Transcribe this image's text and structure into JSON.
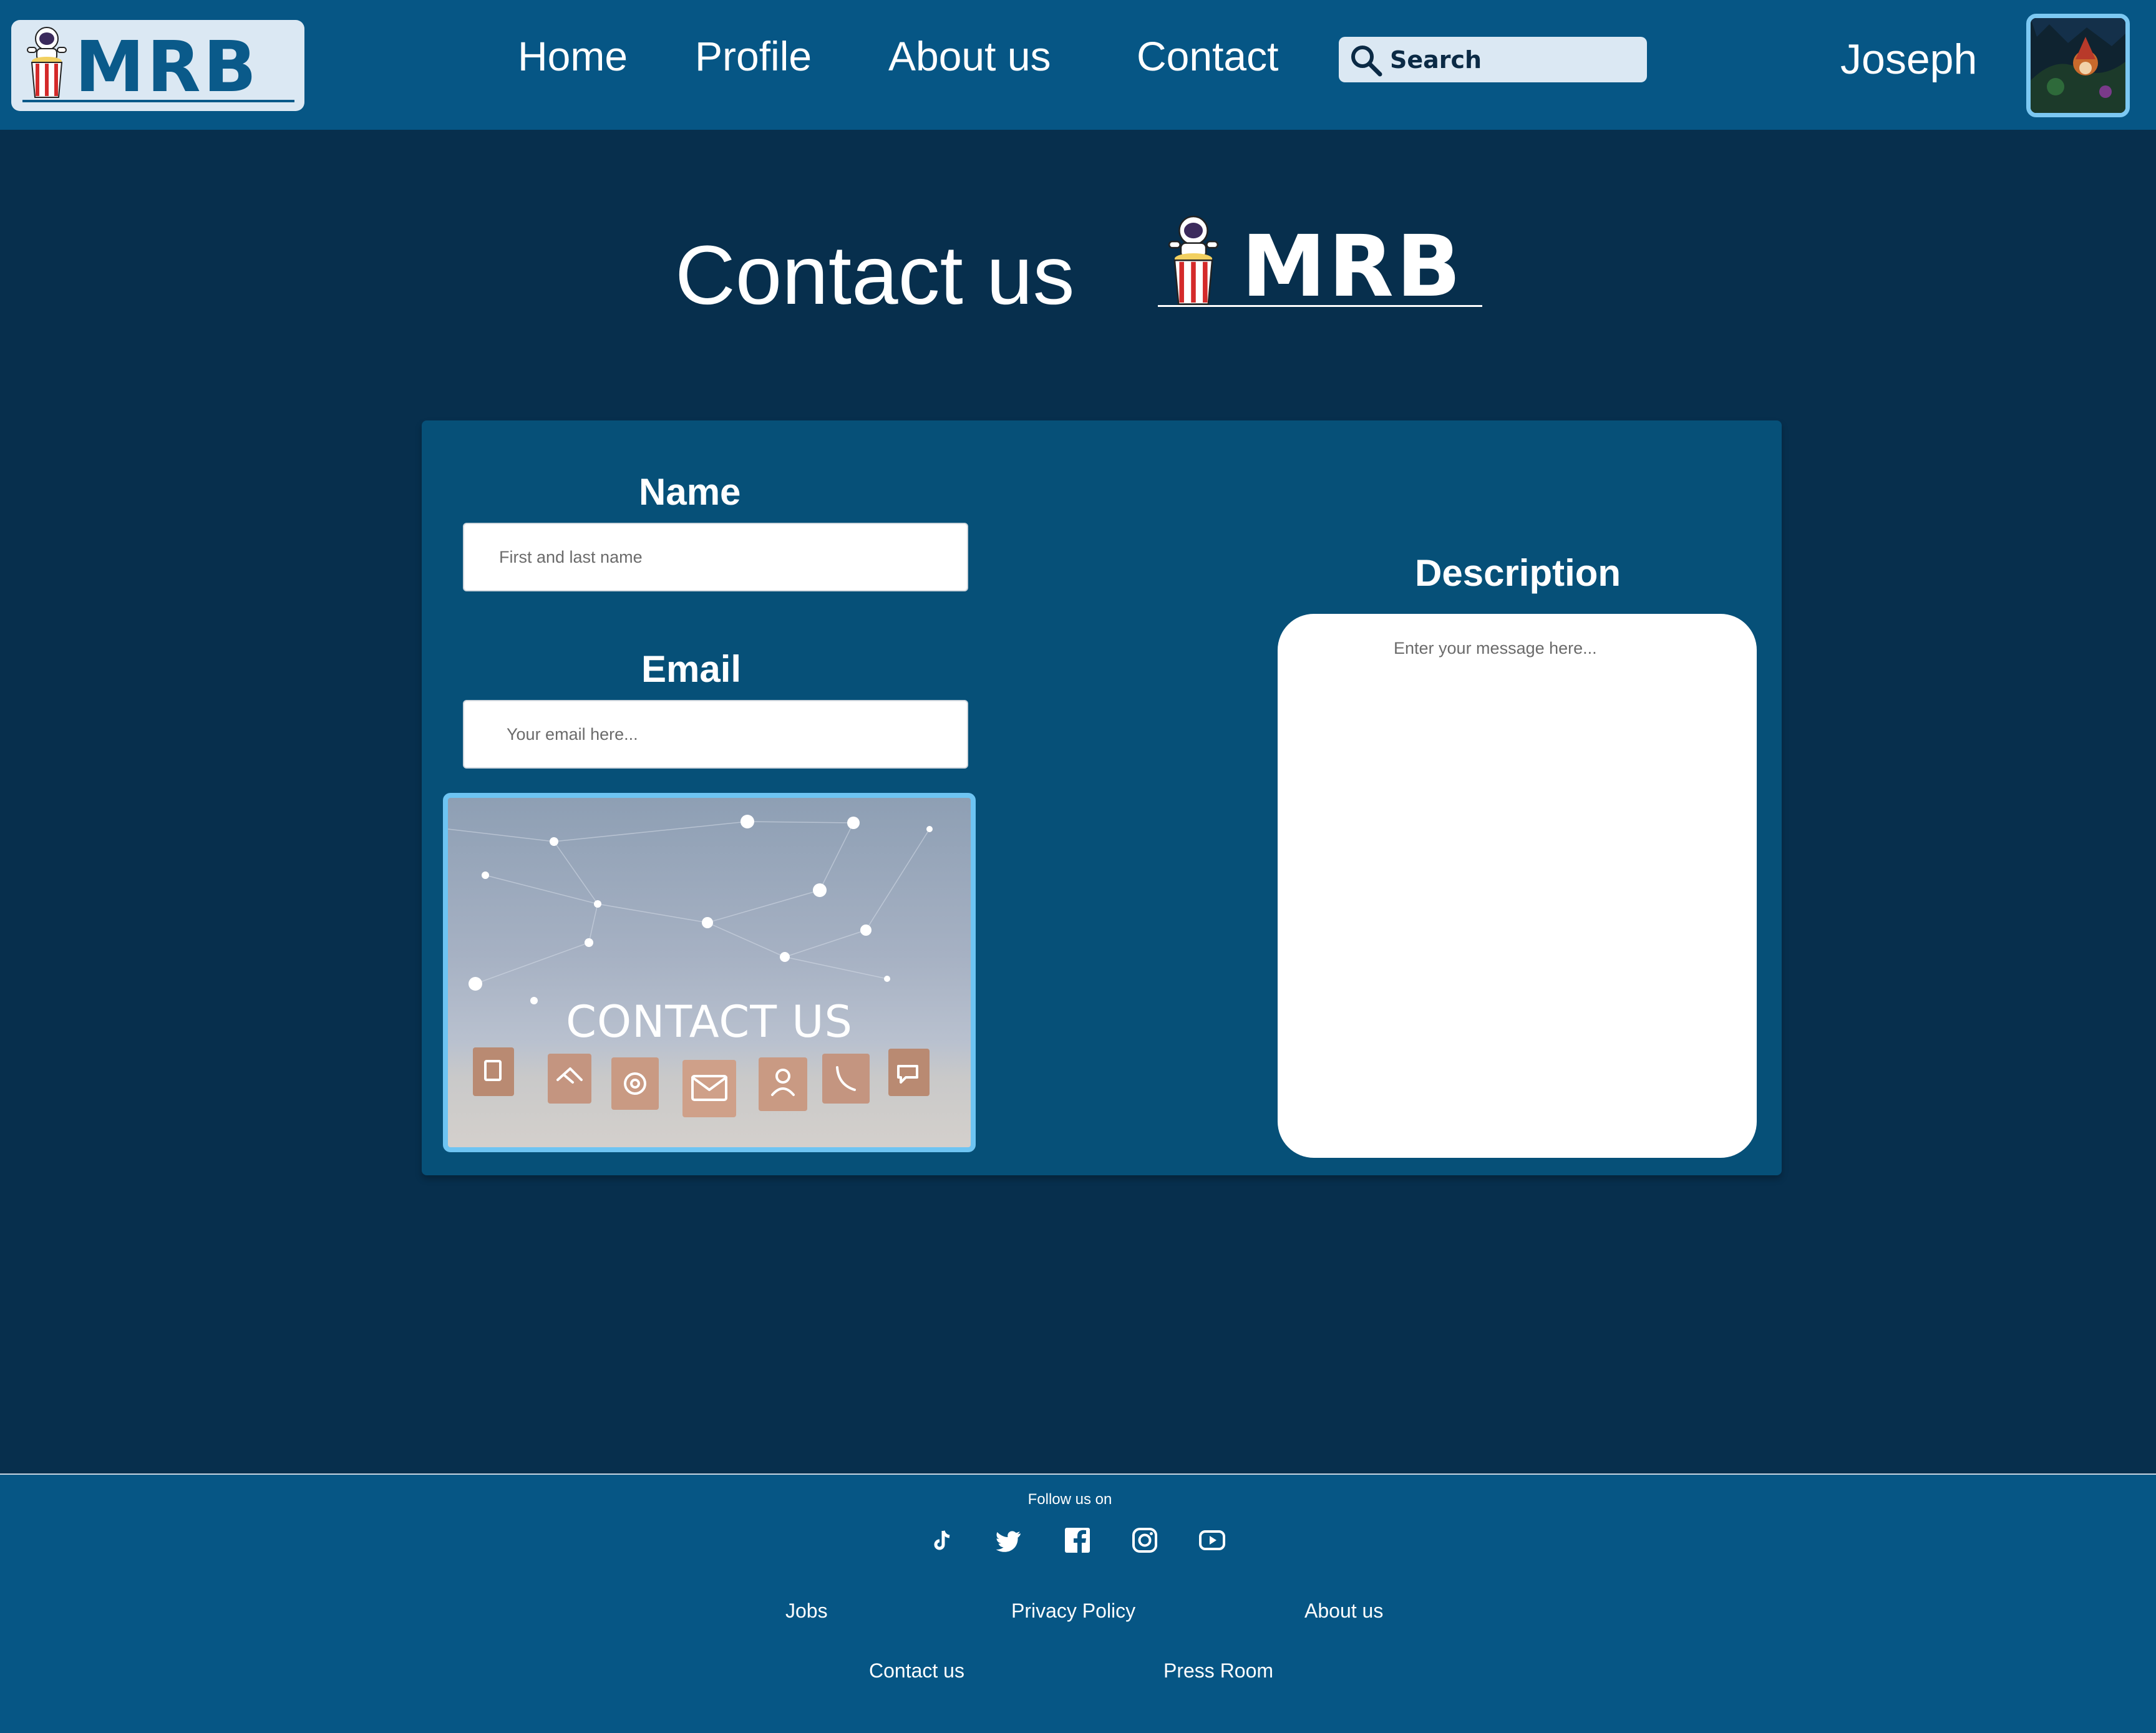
{
  "header": {
    "logo_text": "MRB",
    "nav": [
      "Home",
      "Profile",
      "About us",
      "Contact"
    ],
    "search_placeholder": "Search",
    "username": "Joseph"
  },
  "page": {
    "title": "Contact us",
    "logo_text": "MRB"
  },
  "form": {
    "name_label": "Name",
    "name_placeholder": "First and last name",
    "email_label": "Email",
    "email_placeholder": "Your email here...",
    "description_label": "Description",
    "description_placeholder": "Enter your message here...",
    "image_text": "CONTACT US"
  },
  "footer": {
    "follow_label": "Follow us on",
    "social_icons": [
      "tiktok-icon",
      "twitter-icon",
      "facebook-icon",
      "instagram-icon",
      "youtube-icon"
    ],
    "links_row1": [
      "Jobs",
      "Privacy Policy",
      "About us"
    ],
    "links_row2": [
      "Contact us",
      "Press Room"
    ]
  },
  "colors": {
    "background": "#072f4d",
    "header": "#065685",
    "card": "#065078",
    "accent": "#6ec4f2",
    "logo_blue": "#0a5a8a"
  }
}
